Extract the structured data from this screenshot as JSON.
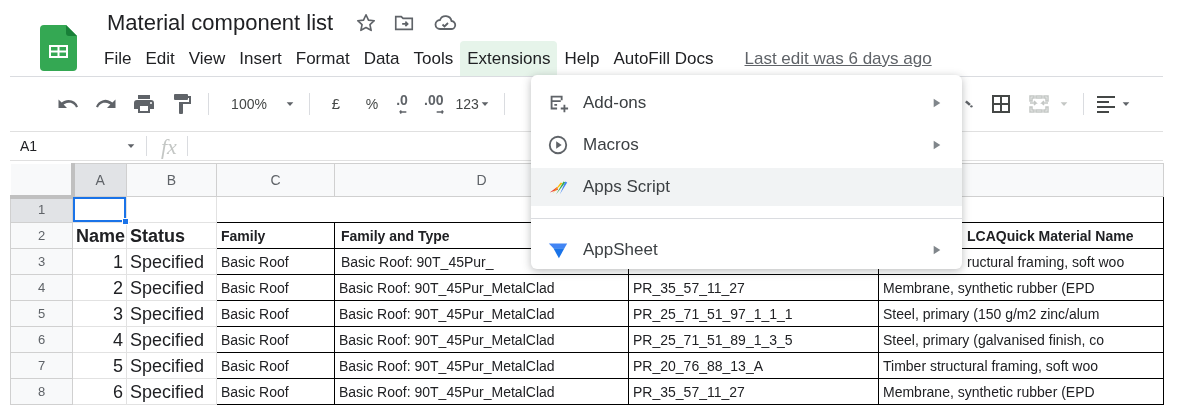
{
  "document": {
    "title": "Material component list"
  },
  "menu_bar": [
    {
      "label": "File",
      "selected": false
    },
    {
      "label": "Edit",
      "selected": false
    },
    {
      "label": "View",
      "selected": false
    },
    {
      "label": "Insert",
      "selected": false
    },
    {
      "label": "Format",
      "selected": false
    },
    {
      "label": "Data",
      "selected": false
    },
    {
      "label": "Tools",
      "selected": false
    },
    {
      "label": "Extensions",
      "selected": true
    },
    {
      "label": "Help",
      "selected": false
    },
    {
      "label": "AutoFill Docs",
      "selected": false
    }
  ],
  "last_edit": "Last edit was 6 days ago",
  "toolbar": {
    "zoom": "100%",
    "currency": "£",
    "percent": "%",
    "decrease_decimals": ".0",
    "increase_decimals": ".00",
    "number_format": "123",
    "merge_cells": {
      "disabled": true
    }
  },
  "formula_bar": {
    "cell_reference": "A1",
    "fx": "fx"
  },
  "extensions_menu": [
    {
      "kind": "item",
      "label": "Add-ons",
      "submenu": true,
      "highlighted": false
    },
    {
      "kind": "item",
      "label": "Macros",
      "submenu": true,
      "highlighted": false
    },
    {
      "kind": "item",
      "label": "Apps Script",
      "submenu": false,
      "highlighted": true
    },
    {
      "kind": "divider"
    },
    {
      "kind": "item",
      "label": "AppSheet",
      "submenu": true,
      "highlighted": false
    }
  ],
  "sheet": {
    "columns": [
      {
        "letter": "A",
        "selected": true
      },
      {
        "letter": "B",
        "selected": false
      },
      {
        "letter": "C",
        "selected": false
      },
      {
        "letter": "D",
        "selected": false
      }
    ],
    "rows": [
      {
        "number": "1",
        "selected": true,
        "cells": [
          null,
          null,
          null,
          null,
          null,
          null
        ]
      },
      {
        "number": "2",
        "selected": false,
        "under_menu": true,
        "cells": [
          "Name",
          "Status",
          "Family",
          "Family and Type",
          null,
          "LCAQuick Material Name"
        ]
      },
      {
        "number": "3",
        "selected": false,
        "under_menu": true,
        "cells": [
          "1",
          "Specified",
          "Basic Roof",
          "Basic Roof: 90T_45Pur_",
          null,
          "ructural framing, soft woo"
        ]
      },
      {
        "number": "4",
        "selected": false,
        "under_menu": false,
        "cells": [
          "2",
          "Specified",
          "Basic Roof",
          "Basic Roof: 90T_45Pur_MetalClad",
          "PR_35_57_11_27",
          "Membrane, synthetic rubber (EPD"
        ]
      },
      {
        "number": "5",
        "selected": false,
        "under_menu": false,
        "cells": [
          "3",
          "Specified",
          "Basic Roof",
          "Basic Roof: 90T_45Pur_MetalClad",
          "PR_25_71_51_97_1_1_1",
          "Steel, primary (150 g/m2 zinc/alum"
        ]
      },
      {
        "number": "6",
        "selected": false,
        "under_menu": false,
        "cells": [
          "4",
          "Specified",
          "Basic Roof",
          "Basic Roof: 90T_45Pur_MetalClad",
          "PR_25_71_51_89_1_3_5",
          "Steel, primary (galvanised finish, co"
        ]
      },
      {
        "number": "7",
        "selected": false,
        "under_menu": false,
        "cells": [
          "5",
          "Specified",
          "Basic Roof",
          "Basic Roof: 90T_45Pur_MetalClad",
          "PR_20_76_88_13_A",
          "Timber structural framing, soft woo"
        ]
      },
      {
        "number": "8",
        "selected": false,
        "under_menu": false,
        "cells": [
          "6",
          "Specified",
          "Basic Roof",
          "Basic Roof: 90T_45Pur_MetalClad",
          "PR_35_57_11_27",
          "Membrane, synthetic rubber (EPD"
        ]
      }
    ]
  }
}
